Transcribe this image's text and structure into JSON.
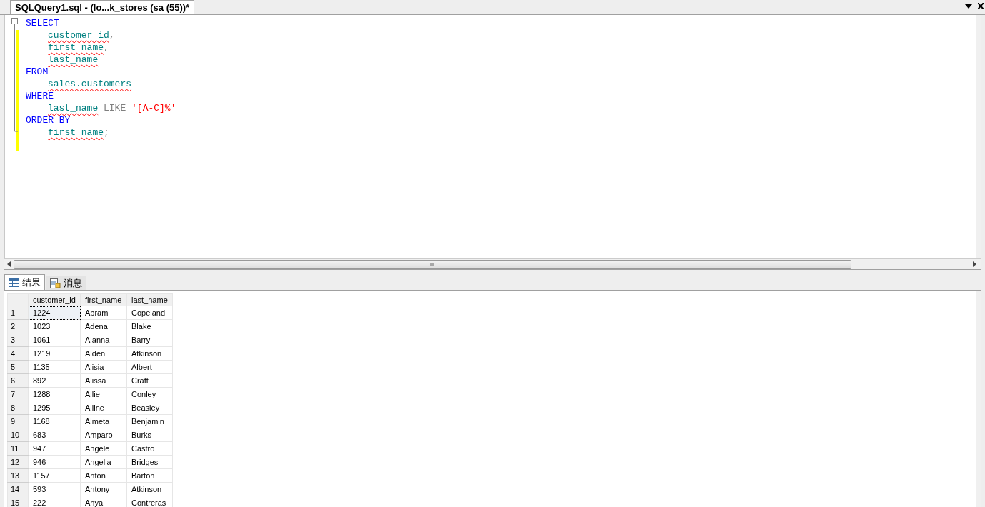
{
  "document_tab": {
    "label": "SQLQuery1.sql - (lo...k_stores (sa (55))*",
    "selected": true
  },
  "editor": {
    "lines": [
      {
        "indent": false,
        "tokens": [
          {
            "kind": "keyword",
            "text": "SELECT"
          }
        ]
      },
      {
        "indent": true,
        "tokens": [
          {
            "kind": "ident",
            "text": "customer_id"
          },
          {
            "kind": "punct",
            "text": ","
          }
        ]
      },
      {
        "indent": true,
        "tokens": [
          {
            "kind": "ident",
            "text": "first_name"
          },
          {
            "kind": "punct",
            "text": ","
          }
        ]
      },
      {
        "indent": true,
        "tokens": [
          {
            "kind": "ident",
            "text": "last_name"
          }
        ]
      },
      {
        "indent": false,
        "tokens": [
          {
            "kind": "keyword",
            "text": "FROM"
          }
        ]
      },
      {
        "indent": true,
        "tokens": [
          {
            "kind": "ident",
            "text": "sales.customers"
          }
        ]
      },
      {
        "indent": false,
        "tokens": [
          {
            "kind": "keyword",
            "text": "WHERE"
          }
        ]
      },
      {
        "indent": true,
        "tokens": [
          {
            "kind": "ident",
            "text": "last_name"
          },
          {
            "kind": "punct",
            "text": " LIKE "
          },
          {
            "kind": "string",
            "text": "'[A-C]%'"
          }
        ]
      },
      {
        "indent": false,
        "tokens": [
          {
            "kind": "keyword",
            "text": "ORDER BY"
          }
        ]
      },
      {
        "indent": true,
        "tokens": [
          {
            "kind": "ident",
            "text": "first_name"
          },
          {
            "kind": "punct",
            "text": ";"
          }
        ]
      }
    ]
  },
  "result_tabs": [
    {
      "label": "结果",
      "selected": true,
      "kind": "grid"
    },
    {
      "label": "消息",
      "selected": false,
      "kind": "messages"
    }
  ],
  "table": {
    "columns": [
      "customer_id",
      "first_name",
      "last_name"
    ],
    "rows": [
      {
        "number": "1",
        "cells": [
          "1224",
          "Abram",
          "Copeland"
        ],
        "selected": true
      },
      {
        "number": "2",
        "cells": [
          "1023",
          "Adena",
          "Blake"
        ],
        "selected": false
      },
      {
        "number": "3",
        "cells": [
          "1061",
          "Alanna",
          "Barry"
        ],
        "selected": false
      },
      {
        "number": "4",
        "cells": [
          "1219",
          "Alden",
          "Atkinson"
        ],
        "selected": false
      },
      {
        "number": "5",
        "cells": [
          "1135",
          "Alisia",
          "Albert"
        ],
        "selected": false
      },
      {
        "number": "6",
        "cells": [
          "892",
          "Alissa",
          "Craft"
        ],
        "selected": false
      },
      {
        "number": "7",
        "cells": [
          "1288",
          "Allie",
          "Conley"
        ],
        "selected": false
      },
      {
        "number": "8",
        "cells": [
          "1295",
          "Alline",
          "Beasley"
        ],
        "selected": false
      },
      {
        "number": "9",
        "cells": [
          "1168",
          "Almeta",
          "Benjamin"
        ],
        "selected": false
      },
      {
        "number": "10",
        "cells": [
          "683",
          "Amparo",
          "Burks"
        ],
        "selected": false
      },
      {
        "number": "11",
        "cells": [
          "947",
          "Angele",
          "Castro"
        ],
        "selected": false
      },
      {
        "number": "12",
        "cells": [
          "946",
          "Angella",
          "Bridges"
        ],
        "selected": false
      },
      {
        "number": "13",
        "cells": [
          "1157",
          "Anton",
          "Barton"
        ],
        "selected": false
      },
      {
        "number": "14",
        "cells": [
          "593",
          "Antony",
          "Atkinson"
        ],
        "selected": false
      },
      {
        "number": "15",
        "cells": [
          "222",
          "Anya",
          "Contreras"
        ],
        "selected": false
      }
    ]
  }
}
